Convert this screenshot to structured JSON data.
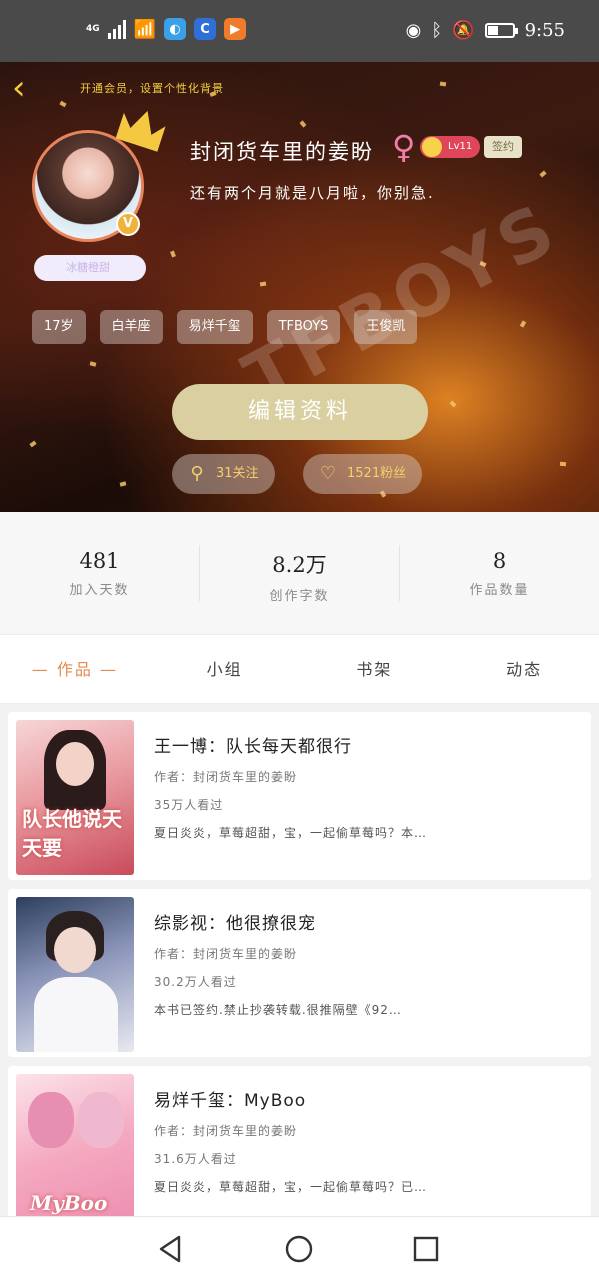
{
  "status_bar": {
    "network": "4G",
    "time": "9:55",
    "icons": [
      "signal-icon",
      "wifi-icon",
      "app-icon",
      "app-icon",
      "app-icon",
      "eye-icon",
      "bluetooth-icon",
      "mute-icon",
      "battery-icon"
    ]
  },
  "header": {
    "hint": "开通会员，设置个性化背景",
    "nickname": "冰糖橙甜",
    "username": "封闭货车里的姜盼",
    "gender_symbol": "♀",
    "level": "Lv11",
    "signed_label": "签约",
    "motto": "还有两个月就是八月啦，你别急.",
    "tags": [
      "17岁",
      "白羊座",
      "易烊千玺",
      "TFBOYS",
      "王俊凯"
    ],
    "edit_label": "编辑资料",
    "following_label": "31关注",
    "fans_label": "1521粉丝",
    "watermark": "TFBOYS",
    "colors": {
      "accent": "#e48a52",
      "gold": "#f5d06a",
      "edit_btn": "#d9cfa1"
    }
  },
  "stats": [
    {
      "value": "481",
      "label": "加入天数"
    },
    {
      "value": "8.2万",
      "label": "创作字数"
    },
    {
      "value": "8",
      "label": "作品数量"
    }
  ],
  "tabs": [
    "— 作品 —",
    "小组",
    "书架",
    "动态"
  ],
  "books": [
    {
      "title": "王一博：队长每天都很行",
      "author": "作者：封闭货车里的姜盼",
      "views": "35万人看过",
      "desc": "夏日炎炎，草莓超甜，宝，一起偷草莓吗？本…",
      "cover_text": "队长他说天天要"
    },
    {
      "title": "综影视：他很撩很宠",
      "author": "作者：封闭货车里的姜盼",
      "views": "30.2万人看过",
      "desc": "本书已签约.禁止抄袭转载.很推隔壁《92…",
      "cover_text": ""
    },
    {
      "title": "易烊千玺：MyBoo",
      "author": "作者：封闭货车里的姜盼",
      "views": "31.6万人看过",
      "desc": "夏日炎炎，草莓超甜，宝，一起偷草莓吗？已…",
      "cover_text": "MyBoo"
    }
  ]
}
